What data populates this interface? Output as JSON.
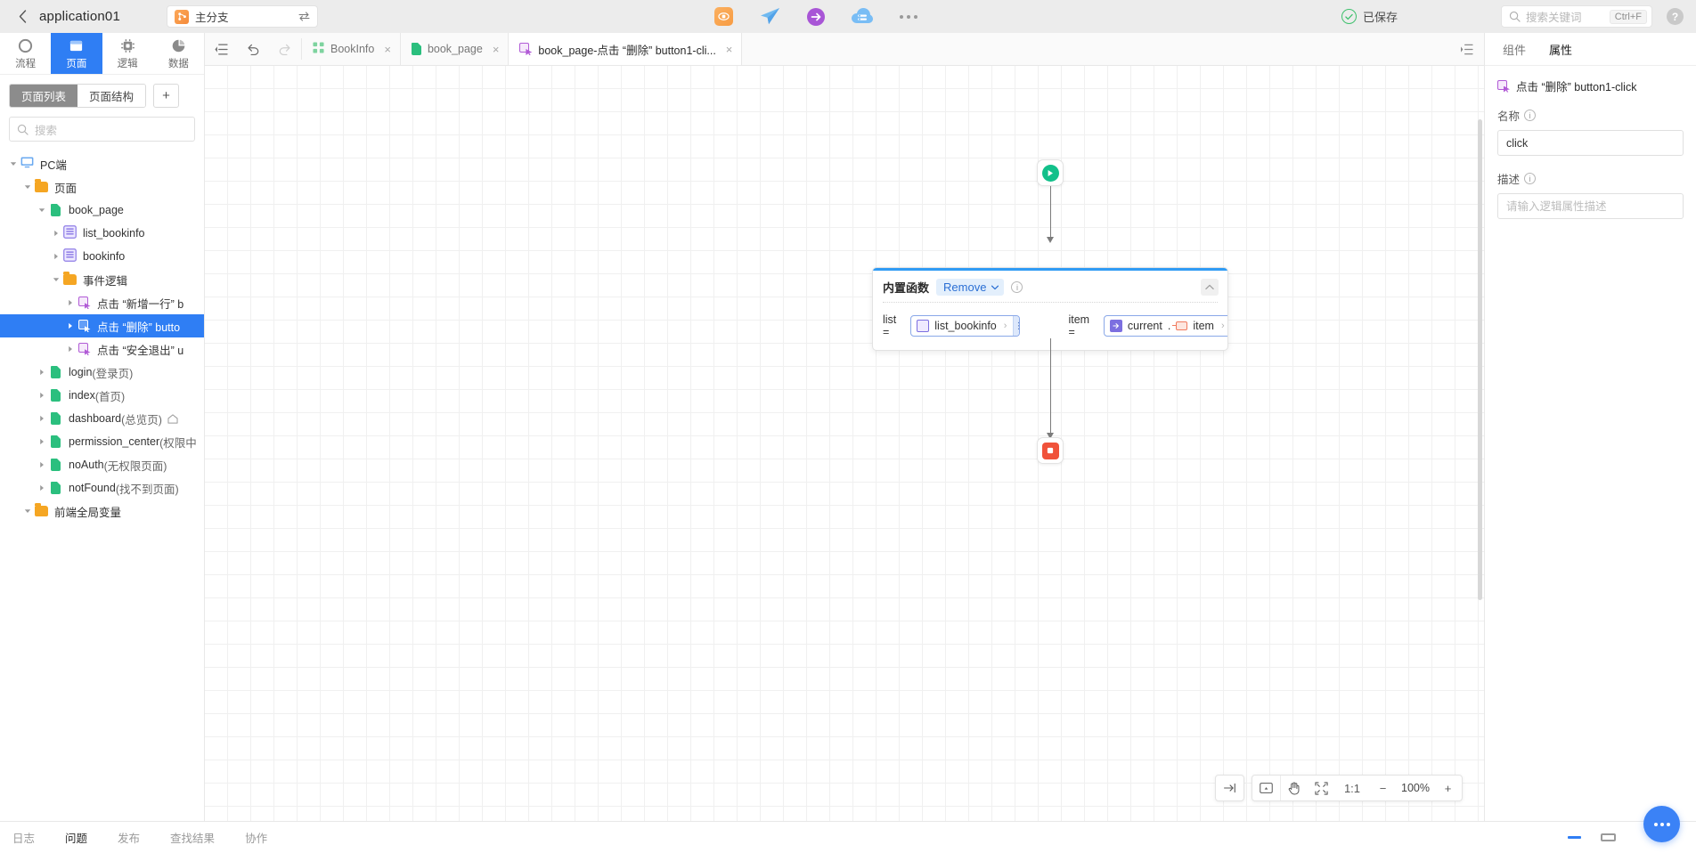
{
  "header": {
    "back_label": "‹",
    "app_title": "application01",
    "branch": {
      "name": "主分支",
      "icon": "branch-icon",
      "swap_icon": "swap-icon"
    },
    "icons": [
      {
        "name": "preview-icon",
        "label": "预览"
      },
      {
        "name": "send-icon",
        "label": "发送"
      },
      {
        "name": "deploy-icon",
        "label": "部署"
      },
      {
        "name": "cloud-icon",
        "label": "云服务"
      },
      {
        "name": "more-icon",
        "label": "更多"
      }
    ],
    "saved_label": "已保存",
    "search": {
      "placeholder": "搜索关键词",
      "shortcut": "Ctrl+F"
    },
    "help_label": "?"
  },
  "left": {
    "mode_tabs": [
      {
        "id": "flow",
        "label": "流程",
        "icon": "flow-icon",
        "active": false
      },
      {
        "id": "page",
        "label": "页面",
        "icon": "page-icon",
        "active": true
      },
      {
        "id": "logic",
        "label": "逻辑",
        "icon": "logic-icon",
        "active": false
      },
      {
        "id": "data",
        "label": "数据",
        "icon": "data-icon",
        "active": false
      }
    ],
    "segments": [
      {
        "id": "page-list",
        "label": "页面列表",
        "active": true
      },
      {
        "id": "page-structure",
        "label": "页面结构",
        "active": false
      }
    ],
    "add_label": "+",
    "search_placeholder": "搜索",
    "tree": [
      {
        "indent": 0,
        "caret": "down",
        "icon": "monitor-icon",
        "label": "PC端",
        "sub": "",
        "selected": false
      },
      {
        "indent": 1,
        "caret": "down",
        "icon": "folder-icon",
        "label": "页面",
        "sub": "",
        "selected": false
      },
      {
        "indent": 2,
        "caret": "down",
        "icon": "page-file-icon",
        "label": "book_page",
        "sub": "",
        "selected": false
      },
      {
        "indent": 3,
        "caret": "right",
        "icon": "component-icon",
        "label": "list_bookinfo",
        "sub": "",
        "selected": false
      },
      {
        "indent": 3,
        "caret": "right",
        "icon": "component-icon",
        "label": "bookinfo",
        "sub": "",
        "selected": false
      },
      {
        "indent": 3,
        "caret": "down",
        "icon": "folder-icon",
        "label": "事件逻辑",
        "sub": "",
        "selected": false
      },
      {
        "indent": 4,
        "caret": "right",
        "icon": "event-icon",
        "label": "点击 “新增一行” b",
        "sub": "",
        "selected": false
      },
      {
        "indent": 4,
        "caret": "right",
        "icon": "event-icon",
        "label": "点击 “删除” butto",
        "sub": "",
        "selected": true
      },
      {
        "indent": 4,
        "caret": "right",
        "icon": "event-icon",
        "label": "点击 “安全退出” u",
        "sub": "",
        "selected": false
      },
      {
        "indent": 2,
        "caret": "right",
        "icon": "page-file-icon",
        "label": "login ",
        "sub": "(登录页)",
        "selected": false
      },
      {
        "indent": 2,
        "caret": "right",
        "icon": "page-file-icon",
        "label": "index ",
        "sub": "(首页)",
        "selected": false
      },
      {
        "indent": 2,
        "caret": "right",
        "icon": "page-file-icon",
        "label": "dashboard ",
        "sub": "(总览页)",
        "selected": false,
        "home": true
      },
      {
        "indent": 2,
        "caret": "right",
        "icon": "page-file-icon",
        "label": "permission_center ",
        "sub": "(权限中",
        "selected": false
      },
      {
        "indent": 2,
        "caret": "right",
        "icon": "page-file-icon",
        "label": "noAuth ",
        "sub": "(无权限页面)",
        "selected": false
      },
      {
        "indent": 2,
        "caret": "right",
        "icon": "page-file-icon",
        "label": "notFound ",
        "sub": "(找不到页面)",
        "selected": false
      },
      {
        "indent": 1,
        "caret": "down",
        "icon": "folder-icon",
        "label": "前端全局变量",
        "sub": "",
        "selected": false
      }
    ]
  },
  "center": {
    "toolbar": {
      "collapse_icon": "collapse-sidebar-icon",
      "undo_icon": "undo-icon",
      "redo_icon": "redo-icon",
      "expand_right_icon": "expand-right-panel-icon"
    },
    "tabs": [
      {
        "id": "bookinfo",
        "label": "BookInfo",
        "icon": "table-icon",
        "active": false
      },
      {
        "id": "book_page",
        "label": "book_page",
        "icon": "page-file-icon",
        "active": false
      },
      {
        "id": "book_page_click_delete",
        "label": "book_page-点击 “删除” button1-cli...",
        "icon": "event-icon",
        "active": true
      }
    ],
    "close_label": "×",
    "flow": {
      "start_node": {
        "name": "start-node",
        "icon": "play-icon"
      },
      "end_node": {
        "name": "end-node",
        "icon": "stop-icon"
      },
      "function_node": {
        "title": "内置函数",
        "function_name": "Remove",
        "info_label": "i",
        "collapse_label": "⌃",
        "params": [
          {
            "key": "list =",
            "tokens": [
              {
                "type": "var",
                "icon": "list-variable-icon",
                "text": "list_bookinfo"
              }
            ],
            "chevron": "›"
          },
          {
            "key": "item =",
            "tokens": [
              {
                "type": "var",
                "icon": "current-variable-icon",
                "text": "current"
              },
              {
                "type": "dot",
                "text": "."
              },
              {
                "type": "var",
                "icon": "item-variable-icon",
                "text": "item"
              }
            ],
            "chevron": "›"
          }
        ]
      }
    },
    "zoombar": {
      "expand_label": "→|",
      "minimap_label": "minimap",
      "hand_label": "hand",
      "fit_label": "fit",
      "actual_size_label": "1:1",
      "minus_label": "−",
      "zoom_level": "100%",
      "plus_label": "+"
    }
  },
  "right": {
    "tabs": [
      {
        "id": "component",
        "label": "组件",
        "active": false
      },
      {
        "id": "property",
        "label": "属性",
        "active": true
      }
    ],
    "title": "点击 “删除” button1-click",
    "fields": [
      {
        "id": "name",
        "label": "名称",
        "info": "i",
        "value": "click",
        "placeholder": ""
      },
      {
        "id": "description",
        "label": "描述",
        "info": "i",
        "value": "",
        "placeholder": "请输入逻辑属性描述"
      }
    ]
  },
  "bottom": {
    "tabs": [
      {
        "id": "log",
        "label": "日志",
        "active": false
      },
      {
        "id": "problem",
        "label": "问题",
        "active": true
      },
      {
        "id": "publish",
        "label": "发布",
        "active": false
      },
      {
        "id": "find",
        "label": "查找结果",
        "active": false
      },
      {
        "id": "collab",
        "label": "协作",
        "active": false
      }
    ],
    "minimize_label": "minimize",
    "restore_label": "restore",
    "chat_label": "chat"
  }
}
